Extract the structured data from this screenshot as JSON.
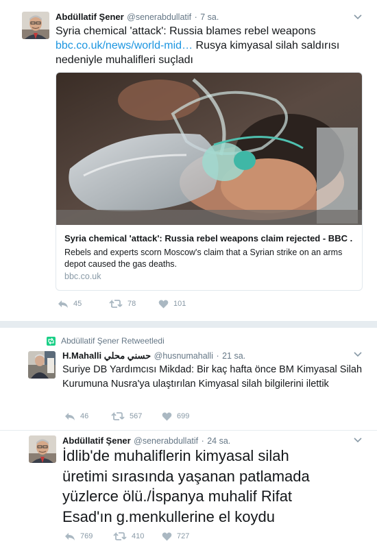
{
  "colors": {
    "link": "#1b95e0",
    "secondary": "#657786",
    "action": "#8899a6",
    "retweet_green": "#19cf86"
  },
  "tweet1": {
    "author_name": "Abdüllatif Şener",
    "handle": "@senerabdullatif",
    "dot": "·",
    "time": "7 sa.",
    "text_plain": "Syria chemical 'attack': Russia blames rebel weapons",
    "link": "bbc.co.uk/news/world-mid…",
    "text_after_link": "Rusya kimyasal silah saldırısı nedeniyle muhalifleri suçladı",
    "card": {
      "title": "Syria chemical 'attack': Russia rebel weapons claim rejected - BBC ...",
      "description": "Rebels and experts scorn Moscow's claim that a Syrian strike on an arms depot caused the gas deaths.",
      "domain": "bbc.co.uk"
    },
    "replies": "45",
    "retweets": "78",
    "likes": "101"
  },
  "retweet_notice": "Abdüllatif Şener Retweetledi",
  "tweet2": {
    "author_name": "H.Mahalli حسني محلي",
    "handle": "@husnumahalli",
    "dot": "·",
    "time": "21 sa.",
    "text": "Suriye DB Yardımcısı Mikdad: Bir kaç hafta önce BM Kimyasal Silah Kurumuna Nusra'ya ulaştırılan Kimyasal silah bilgilerini ilettik",
    "replies": "46",
    "retweets": "567",
    "likes": "699"
  },
  "tweet3": {
    "author_name": "Abdüllatif Şener",
    "handle": "@senerabdullatif",
    "dot": "·",
    "time": "24 sa.",
    "text": "İdlib'de muhaliflerin kimyasal silah üretimi sırasında yaşanan patlamada yüzlerce ölü./İspanya muhalif Rifat Esad'ın g.menkullerine el koydu",
    "replies": "769",
    "retweets": "410",
    "likes": "727"
  }
}
